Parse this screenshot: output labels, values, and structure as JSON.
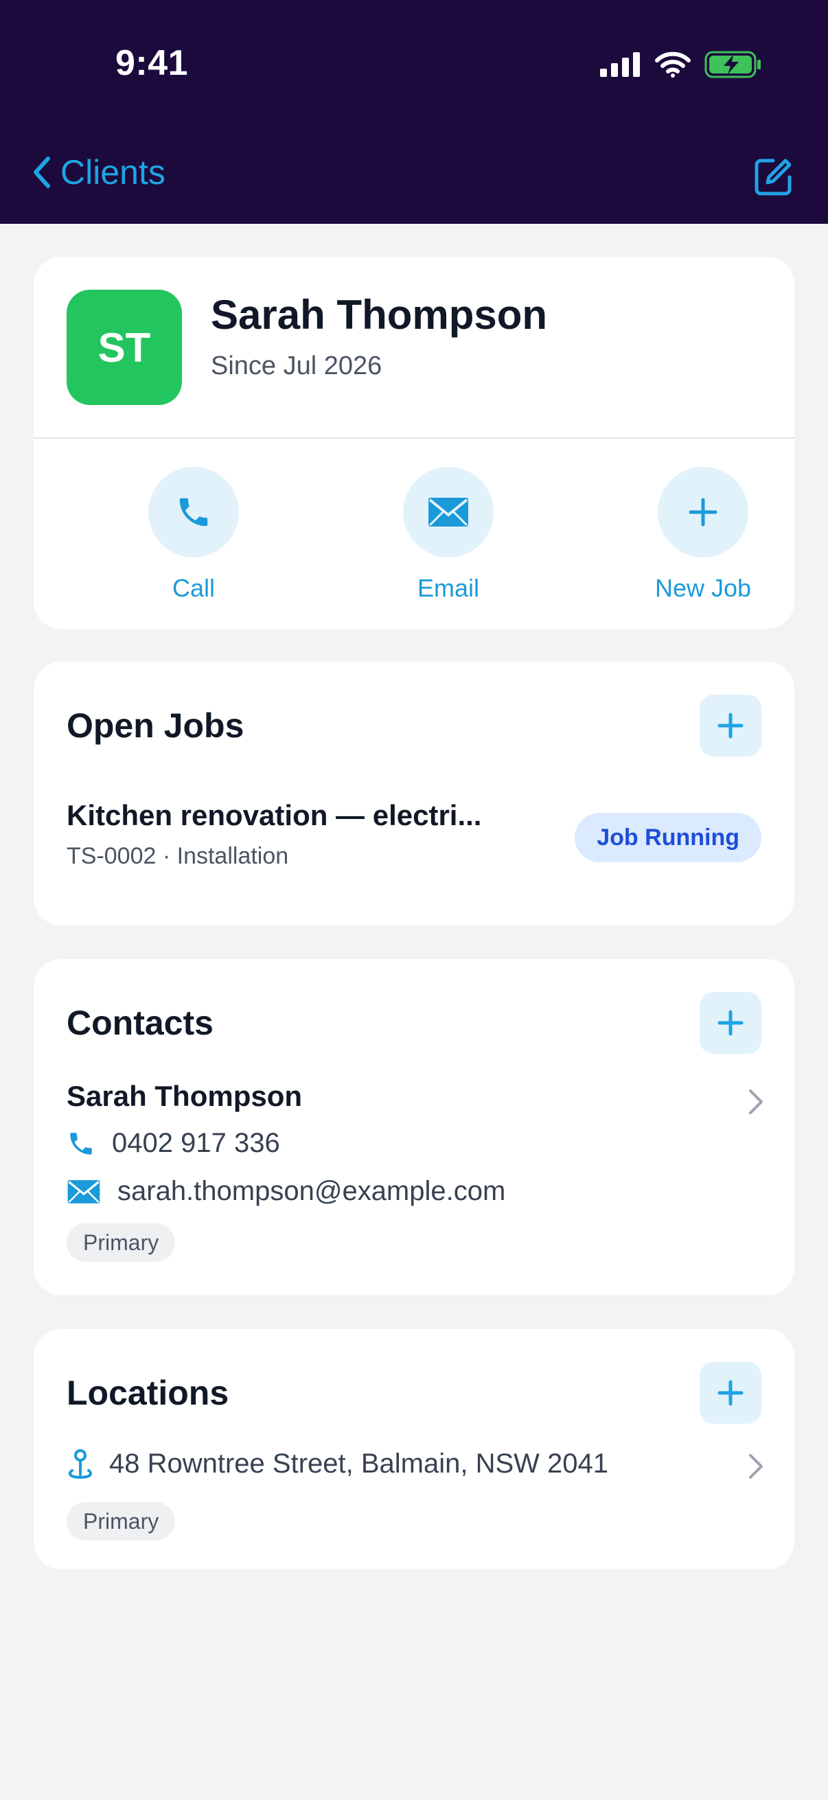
{
  "status_bar": {
    "time": "9:41"
  },
  "nav": {
    "back_label": "Clients"
  },
  "client": {
    "initials": "ST",
    "name": "Sarah Thompson",
    "since": "Since Jul 2026"
  },
  "actions": [
    {
      "label": "Call",
      "icon": "phone-icon"
    },
    {
      "label": "Email",
      "icon": "mail-icon"
    },
    {
      "label": "New Job",
      "icon": "plus-icon"
    }
  ],
  "open_jobs": {
    "title": "Open Jobs",
    "items": [
      {
        "title": "Kitchen renovation — electri...",
        "subtitle": "TS-0002 · Installation",
        "status": "Job Running"
      }
    ]
  },
  "contacts": {
    "title": "Contacts",
    "items": [
      {
        "name": "Sarah Thompson",
        "phone": "0402 917 336",
        "email": "sarah.thompson@example.com",
        "tag": "Primary"
      }
    ]
  },
  "locations": {
    "title": "Locations",
    "items": [
      {
        "address": "48 Rowntree Street, Balmain, NSW 2041",
        "tag": "Primary"
      }
    ]
  },
  "colors": {
    "header_bg": "#1c0a3c",
    "accent": "#1fa3e6",
    "avatar_bg": "#23c55e",
    "badge_bg": "#dbeafe",
    "badge_text": "#1d4ed8",
    "page_bg": "#f2f3f5"
  }
}
